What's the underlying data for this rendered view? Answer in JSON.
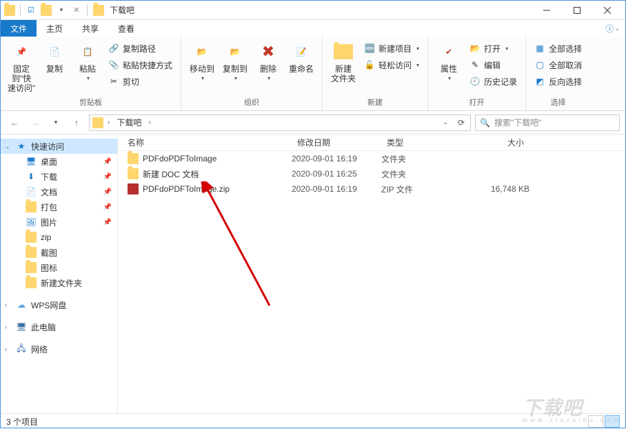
{
  "window": {
    "title": "下载吧"
  },
  "tabs": {
    "file": "文件",
    "home": "主页",
    "share": "共享",
    "view": "查看"
  },
  "ribbon": {
    "pin": "固定到\"快\n速访问\"",
    "copy": "复制",
    "paste": "粘贴",
    "copy_path": "复制路径",
    "paste_shortcut": "粘贴快捷方式",
    "cut": "剪切",
    "group_clipboard": "剪贴板",
    "move_to": "移动到",
    "copy_to": "复制到",
    "delete": "删除",
    "rename": "重命名",
    "group_organize": "组织",
    "new_folder": "新建\n文件夹",
    "new_item": "新建项目",
    "easy_access": "轻松访问",
    "group_new": "新建",
    "properties": "属性",
    "open": "打开",
    "edit": "编辑",
    "history": "历史记录",
    "group_open": "打开",
    "select_all": "全部选择",
    "select_none": "全部取消",
    "invert": "反向选择",
    "group_select": "选择"
  },
  "address": {
    "root": "下载吧",
    "search_placeholder": "搜索\"下载吧\""
  },
  "nav": {
    "quick": "快速访问",
    "desktop": "桌面",
    "downloads": "下载",
    "documents": "文档",
    "dabao": "打包",
    "pictures": "图片",
    "zip": "zip",
    "jietu": "截图",
    "tubiao": "图标",
    "newfolder": "新建文件夹",
    "wps": "WPS网盘",
    "thispc": "此电脑",
    "network": "网络"
  },
  "columns": {
    "name": "名称",
    "date": "修改日期",
    "type": "类型",
    "size": "大小"
  },
  "files": [
    {
      "icon": "folder",
      "name": "PDFdoPDFToImage",
      "date": "2020-09-01 16:19",
      "type": "文件夹",
      "size": ""
    },
    {
      "icon": "folder",
      "name": "新建 DOC 文档",
      "date": "2020-09-01 16:25",
      "type": "文件夹",
      "size": ""
    },
    {
      "icon": "zip",
      "name": "PDFdoPDFToImage.zip",
      "date": "2020-09-01 16:19",
      "type": "ZIP 文件",
      "size": "16,748 KB"
    }
  ],
  "status": {
    "count": "3 个项目"
  },
  "watermark": {
    "big": "下载吧",
    "small": "www.xiazaiba.com"
  }
}
